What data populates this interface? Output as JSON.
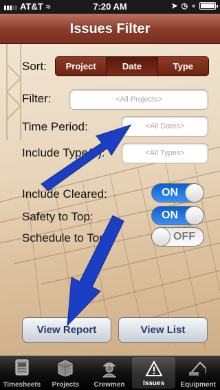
{
  "status_bar": {
    "carrier": "AT&T",
    "time": "7:20 AM"
  },
  "nav": {
    "title": "Issues Filter"
  },
  "sort": {
    "label": "Sort:",
    "options": [
      "Project",
      "Date",
      "Type"
    ],
    "selected": "Date"
  },
  "filter": {
    "label": "Filter:",
    "placeholder": "<All Projects>"
  },
  "time_period": {
    "label": "Time Period:",
    "placeholder": "<All Dates>"
  },
  "include_types": {
    "label": "Include Type(s):",
    "placeholder": "<All Types>"
  },
  "include_cleared": {
    "label": "Include Cleared:",
    "state": "ON"
  },
  "safety_to_top": {
    "label": "Safety to Top:",
    "state": "ON"
  },
  "schedule_to_top": {
    "label": "Schedule to Top:",
    "state": "OFF"
  },
  "buttons": {
    "view_report": "View Report",
    "view_list": "View List"
  },
  "tabs": [
    {
      "label": "Timesheets",
      "icon": "timesheet-icon"
    },
    {
      "label": "Projects",
      "icon": "projects-icon"
    },
    {
      "label": "Crewmen",
      "icon": "crewman-icon"
    },
    {
      "label": "Issues",
      "icon": "warning-icon",
      "selected": true
    },
    {
      "label": "Equipment",
      "icon": "crane-icon"
    }
  ],
  "colors": {
    "nav_bar": "#8a3b28",
    "toggle_on": "#1a6fe0",
    "arrow": "#1b3fc4"
  }
}
